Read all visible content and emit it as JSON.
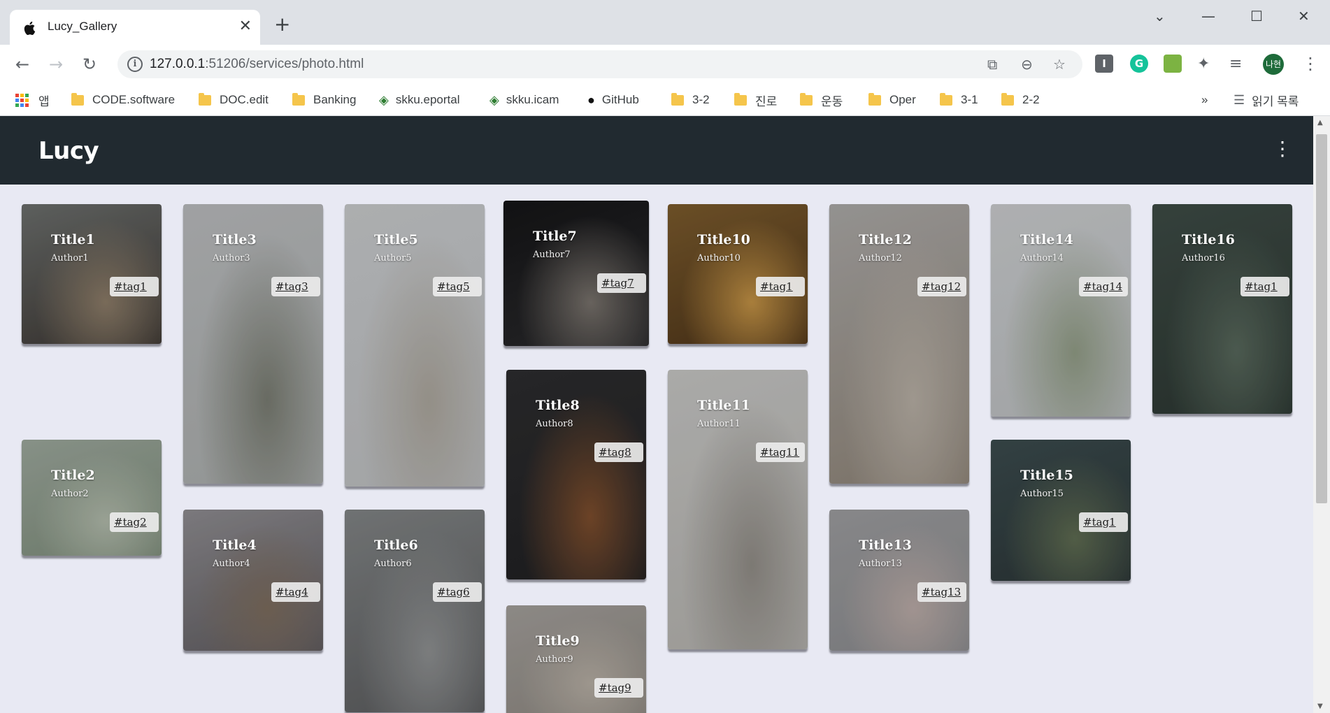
{
  "browser": {
    "tab": {
      "title": "Lucy_Gallery",
      "close": "✕"
    },
    "new_tab": "+",
    "window_controls": {
      "chevron": "⌄",
      "minimize": "—",
      "maximize": "☐",
      "close": "✕"
    },
    "url": {
      "host": "127.0.0.1",
      "rest": ":51206/services/photo.html"
    },
    "profile_label": "나현",
    "bookmarks": [
      {
        "label": "앱",
        "type": "apps"
      },
      {
        "label": "CODE.software",
        "type": "folder"
      },
      {
        "label": "DOC.edit",
        "type": "folder"
      },
      {
        "label": "Banking",
        "type": "folder"
      },
      {
        "label": "skku.eportal",
        "type": "site"
      },
      {
        "label": "skku.icam",
        "type": "site"
      },
      {
        "label": "GitHub",
        "type": "github"
      },
      {
        "label": "3-2",
        "type": "folder"
      },
      {
        "label": "진로",
        "type": "folder"
      },
      {
        "label": "운동",
        "type": "folder"
      },
      {
        "label": "Oper",
        "type": "folder"
      },
      {
        "label": "3-1",
        "type": "folder"
      },
      {
        "label": "2-2",
        "type": "folder"
      }
    ],
    "bookmarks_overflow": "»",
    "reading_list": "읽기 목록"
  },
  "app": {
    "brand": "Lucy",
    "menu_icon": "⋮"
  },
  "cards": [
    {
      "title": "Title1",
      "author": "Author1",
      "tag": "#tag1",
      "colors": [
        "#6a6d6b",
        "#3a3531",
        "#8a7a66"
      ]
    },
    {
      "title": "Title2",
      "author": "Author2",
      "tag": "#tag2",
      "colors": [
        "#9aa59a",
        "#7b8a78",
        "#aeb7a8"
      ]
    },
    {
      "title": "Title3",
      "author": "Author3",
      "tag": "#tag3",
      "colors": [
        "#b6b8ba",
        "#a7aaa9",
        "#777a70"
      ]
    },
    {
      "title": "Title4",
      "author": "Author4",
      "tag": "#tag4",
      "colors": [
        "#8c8a8e",
        "#5d5a5e",
        "#7a6a5c"
      ]
    },
    {
      "title": "Title5",
      "author": "Author5",
      "tag": "#tag5",
      "colors": [
        "#c4c6c8",
        "#b9bbbd",
        "#a8a39a"
      ]
    },
    {
      "title": "Title6",
      "author": "Author6",
      "tag": "#tag6",
      "colors": [
        "#7f8283",
        "#58595b",
        "#8c8e8f"
      ]
    },
    {
      "title": "Title7",
      "author": "Author7",
      "tag": "#tag7",
      "colors": [
        "#141416",
        "#2a2a2c",
        "#76706a"
      ]
    },
    {
      "title": "Title8",
      "author": "Author8",
      "tag": "#tag8",
      "colors": [
        "#2c2c2e",
        "#1f1f21",
        "#7b4c2c"
      ]
    },
    {
      "title": "Title9",
      "author": "Author9",
      "tag": "#tag9",
      "colors": [
        "#a09c98",
        "#8a857e",
        "#b3aba1"
      ]
    },
    {
      "title": "Title10",
      "author": "Author10",
      "tag": "#tag1",
      "colors": [
        "#7a5a2c",
        "#4a3218",
        "#c09044"
      ]
    },
    {
      "title": "Title11",
      "author": "Author11",
      "tag": "#tag11",
      "colors": [
        "#c2c2c0",
        "#b1afab",
        "#8e8a84"
      ]
    },
    {
      "title": "Title12",
      "author": "Author12",
      "tag": "#tag12",
      "colors": [
        "#a8a6a4",
        "#8c8276",
        "#b4aca2"
      ]
    },
    {
      "title": "Title13",
      "author": "Author13",
      "tag": "#tag13",
      "colors": [
        "#9a9a9c",
        "#88898c",
        "#b7a8a4"
      ]
    },
    {
      "title": "Title14",
      "author": "Author14",
      "tag": "#tag14",
      "colors": [
        "#c6c8ca",
        "#b8bbbd",
        "#8f9a84"
      ]
    },
    {
      "title": "Title15",
      "author": "Author15",
      "tag": "#tag1",
      "colors": [
        "#3a4a4c",
        "#2a3436",
        "#5d6a50"
      ]
    },
    {
      "title": "Title16",
      "author": "Author16",
      "tag": "#tag1",
      "colors": [
        "#3d4a44",
        "#2b3631",
        "#56665a"
      ]
    }
  ]
}
